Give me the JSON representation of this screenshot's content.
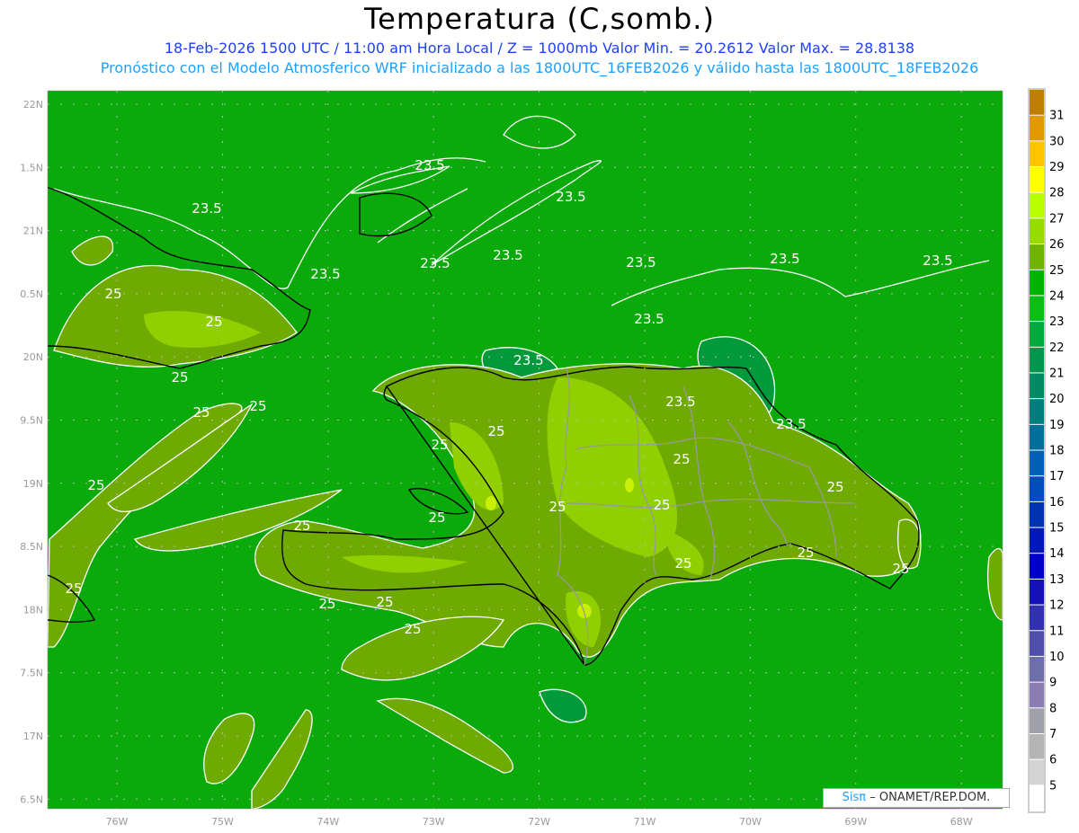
{
  "header": {
    "title": "Temperatura (C,somb.)",
    "line1": "18-Feb-2026 1500 UTC / 11:00 am Hora Local / Z = 1000mb   Valor Min. = 20.2612   Valor Max. = 28.8138",
    "line2": "Pronóstico con el Modelo Atmosferico WRF inicializado a las 1800UTC_16FEB2026 y válido hasta las  1800UTC_18FEB2026"
  },
  "map": {
    "variable": "temperature",
    "units": "C",
    "level": "1000mb",
    "value_min": 20.2612,
    "value_max": 28.8138,
    "lat_labels": [
      "22N",
      "1.5N",
      "21N",
      "0.5N",
      "20N",
      "9.5N",
      "19N",
      "8.5N",
      "18N",
      "7.5N",
      "17N",
      "6.5N"
    ],
    "lon_labels": [
      "76W",
      "75W",
      "74W",
      "73W",
      "72W",
      "71W",
      "70W",
      "69W",
      "68W"
    ],
    "contour_labels": [
      "23.5",
      "23.5",
      "23.5",
      "23.5",
      "23.5",
      "23.5",
      "23.5",
      "23.5",
      "23.5",
      "23.5",
      "23.5",
      "23.5",
      "23.5",
      "25",
      "25",
      "25",
      "25",
      "25",
      "25",
      "25",
      "25",
      "25",
      "25",
      "25",
      "25",
      "25",
      "25",
      "25",
      "25",
      "25",
      "25",
      "25",
      "25",
      "25"
    ],
    "background_color": "#0aaa0a"
  },
  "colorbar": {
    "labels": [
      "31",
      "30",
      "29",
      "28",
      "27",
      "26",
      "25",
      "24",
      "23",
      "22",
      "21",
      "20",
      "19",
      "18",
      "17",
      "16",
      "15",
      "14",
      "13",
      "12",
      "11",
      "10",
      "9",
      "8",
      "7",
      "6",
      "5"
    ],
    "colors": [
      "#c07e00",
      "#e09a00",
      "#ffc600",
      "#ffff00",
      "#b8ff00",
      "#96dc00",
      "#6eb400",
      "#00b400",
      "#0abe14",
      "#00aa3c",
      "#00964e",
      "#008a64",
      "#007e7e",
      "#006e9a",
      "#0060b8",
      "#004cbe",
      "#0032b4",
      "#0018b8",
      "#0000c8",
      "#1412b4",
      "#3232b0",
      "#5050aa",
      "#6e6eaa",
      "#8c7cb4",
      "#a0a0aa",
      "#b4b4b4",
      "#d4d4d4",
      "#ffffff"
    ]
  },
  "credit": {
    "logo": "Sisπ",
    "text": "– ONAMET/REP.DOM."
  }
}
